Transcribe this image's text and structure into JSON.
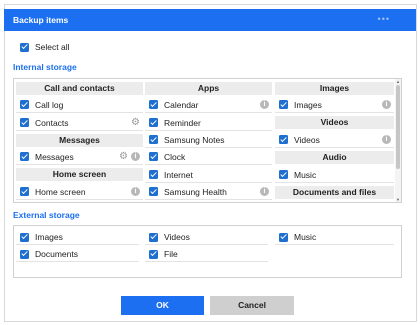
{
  "dialog": {
    "title": "Backup items"
  },
  "select_all": {
    "label": "Select all",
    "checked": true
  },
  "internal": {
    "label": "Internal storage",
    "col1": {
      "cat1": "Call and contacts",
      "cat1_items": [
        "Call log",
        "Contacts"
      ],
      "cat2": "Messages",
      "cat2_items": [
        "Messages"
      ],
      "cat3": "Home screen",
      "cat3_items": [
        "Home screen"
      ]
    },
    "col2": {
      "cat1": "Apps",
      "cat1_items": [
        "Calendar",
        "Reminder",
        "Samsung Notes",
        "Clock",
        "Internet",
        "Samsung Health"
      ]
    },
    "col3": {
      "cat1": "Images",
      "cat1_items": [
        "Images"
      ],
      "cat2": "Videos",
      "cat2_items": [
        "Videos"
      ],
      "cat3": "Audio",
      "cat3_items": [
        "Music"
      ],
      "cat4": "Documents and files"
    }
  },
  "external": {
    "label": "External storage",
    "items": [
      "Images",
      "Videos",
      "Music",
      "Documents",
      "File"
    ]
  },
  "buttons": {
    "ok": "OK",
    "cancel": "Cancel"
  },
  "colors": {
    "accent": "#1b6ff0",
    "checkbox": "#1f6fd1",
    "cancel_bg": "#cfcfcf"
  },
  "icons": {
    "info": "i",
    "settings": "⚙",
    "menu": "•••"
  }
}
